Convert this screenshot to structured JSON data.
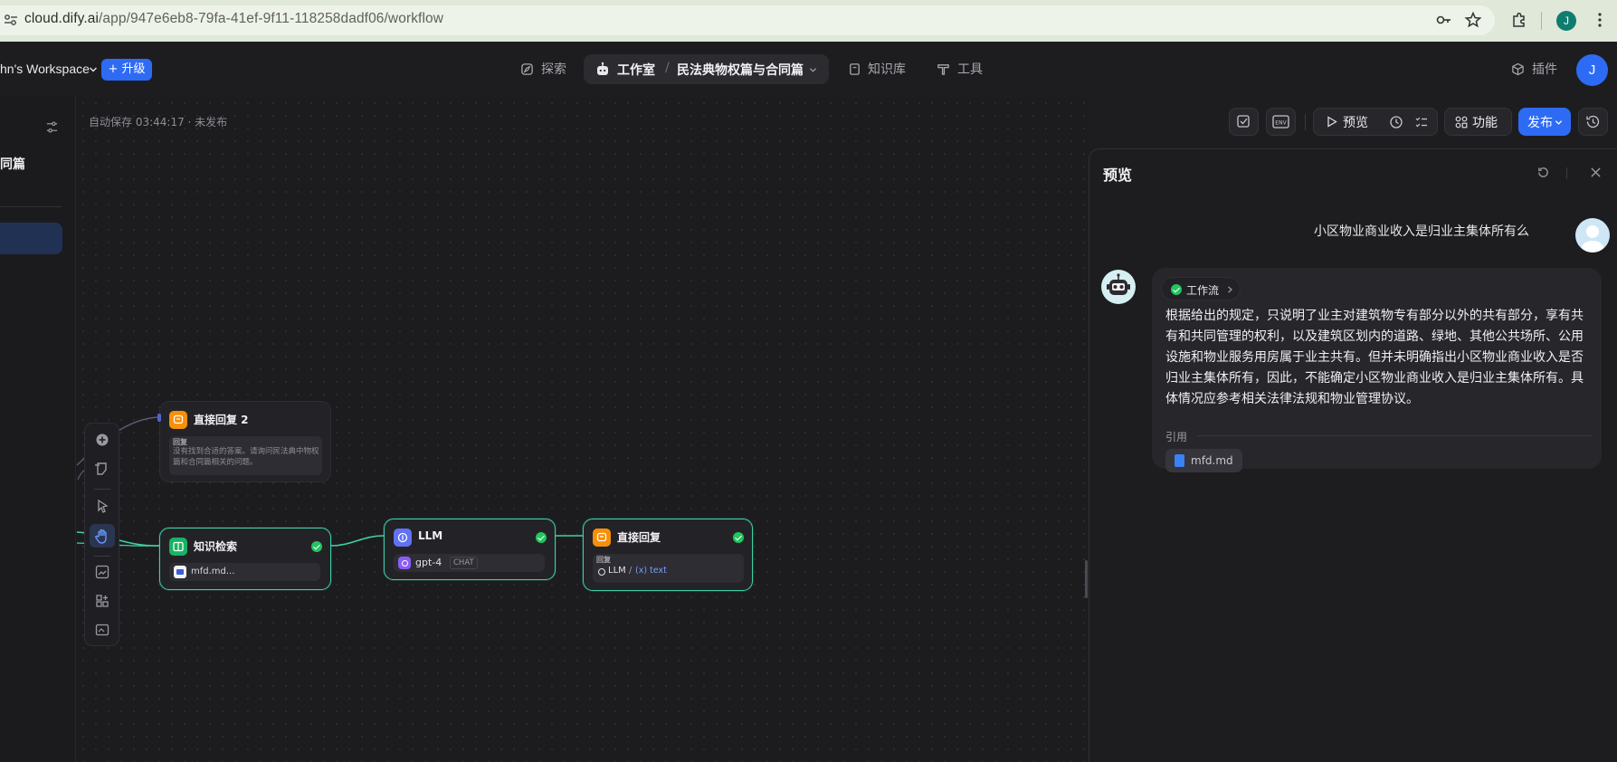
{
  "browser": {
    "url_main": "cloud.dify.ai",
    "url_rest": "/app/947e6eb8-79fa-41ef-9f11-118258dadf06/workflow",
    "profile_initial": "J"
  },
  "header": {
    "workspace_name": "hn's Workspace",
    "upgrade_label": "+ 升级",
    "nav": {
      "explore": "探索",
      "studio": "工作室",
      "app_name": "民法典物权篇与合同篇",
      "knowledge": "知识库",
      "tools": "工具"
    },
    "plugins": "插件",
    "user_initial": "J"
  },
  "sidebar": {
    "app_title_fragment": "同篇"
  },
  "canvas": {
    "autosave": "自动保存 03:44:17 · 未发布"
  },
  "nodes": {
    "answer2": {
      "title": "直接回复 2",
      "field_label": "回复",
      "text": "没有找到合适的答案。请询问民法典中物权篇和合同篇相关的问题。"
    },
    "knowledge": {
      "title": "知识检索",
      "file": "mfd.md..."
    },
    "llm": {
      "title": "LLM",
      "model": "gpt-4",
      "badge": "CHAT"
    },
    "answer": {
      "title": "直接回复",
      "field_label": "回复",
      "var_node": "LLM",
      "var_slash": "/",
      "var_name": "(x) text"
    }
  },
  "toolbar": {
    "preview": "预览",
    "features": "功能",
    "publish": "发布"
  },
  "preview": {
    "title": "预览",
    "user_question": "小区物业商业收入是归业主集体所有么",
    "workflow_label": "工作流",
    "answer": "根据给出的规定，只说明了业主对建筑物专有部分以外的共有部分，享有共有和共同管理的权利，以及建筑区划内的道路、绿地、其他公共场所、公用设施和物业服务用房属于业主共有。但并未明确指出小区物业商业收入是否归业主集体所有，因此，不能确定小区物业商业收入是归业主集体所有。具体情况应参考相关法律法规和物业管理协议。",
    "citation_label": "引用",
    "citation_file": "mfd.md"
  },
  "colors": {
    "accent_blue": "#2e6bf5",
    "success_green": "#22c55e",
    "edge_teal": "#3fd1a6"
  }
}
